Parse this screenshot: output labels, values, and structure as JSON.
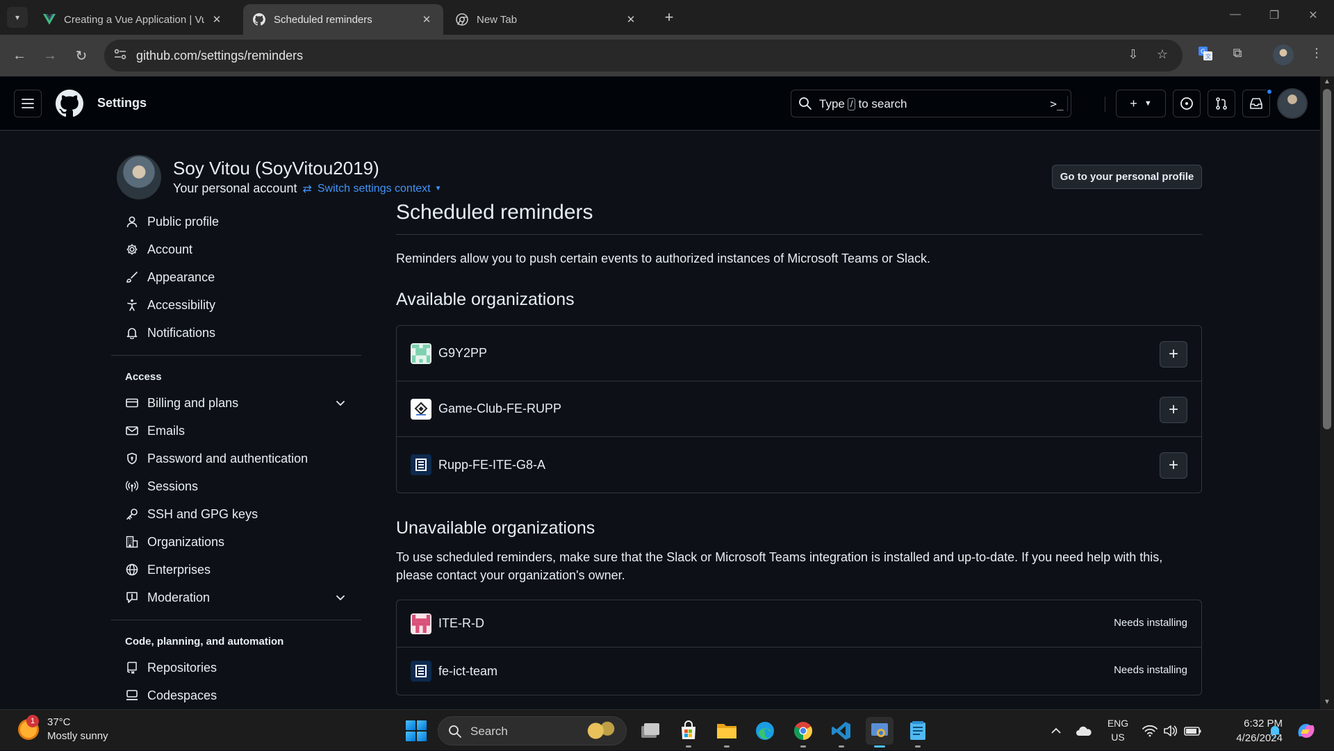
{
  "browser": {
    "tabs": [
      {
        "title": "Creating a Vue Application | Vu",
        "icon": "vue-icon",
        "active": false
      },
      {
        "title": "Scheduled reminders",
        "icon": "github-icon",
        "active": true
      },
      {
        "title": "New Tab",
        "icon": "chrome-icon",
        "active": false
      }
    ],
    "url": "github.com/settings/reminders"
  },
  "header": {
    "context": "Settings",
    "search_prefix": "Type",
    "search_key": "/",
    "search_suffix": "to search"
  },
  "profile": {
    "name": "Soy Vitou (SoyVitou2019)",
    "subtitle": "Your personal account",
    "switch_label": "Switch settings context",
    "go_profile_label": "Go to your personal profile"
  },
  "sidebar": {
    "group1": [
      {
        "label": "Public profile",
        "icon": "person-icon"
      },
      {
        "label": "Account",
        "icon": "gear-icon"
      },
      {
        "label": "Appearance",
        "icon": "paintbrush-icon"
      },
      {
        "label": "Accessibility",
        "icon": "accessibility-icon"
      },
      {
        "label": "Notifications",
        "icon": "bell-icon"
      }
    ],
    "access_heading": "Access",
    "group2": [
      {
        "label": "Billing and plans",
        "icon": "credit-card-icon"
      },
      {
        "label": "Emails",
        "icon": "mail-icon"
      },
      {
        "label": "Password and authentication",
        "icon": "shield-lock-icon"
      },
      {
        "label": "Sessions",
        "icon": "broadcast-icon"
      },
      {
        "label": "SSH and GPG keys",
        "icon": "key-icon"
      },
      {
        "label": "Organizations",
        "icon": "organization-icon"
      },
      {
        "label": "Enterprises",
        "icon": "globe-icon"
      },
      {
        "label": "Moderation",
        "icon": "report-icon"
      }
    ],
    "code_heading": "Code, planning, and automation",
    "group3": [
      {
        "label": "Repositories",
        "icon": "repo-icon"
      },
      {
        "label": "Codespaces",
        "icon": "codespaces-icon"
      }
    ]
  },
  "main": {
    "title": "Scheduled reminders",
    "lead": "Reminders allow you to push certain events to authorized instances of Microsoft Teams or Slack.",
    "available_heading": "Available organizations",
    "available": [
      "G9Y2PP",
      "Game-Club-FE-RUPP",
      "Rupp-FE-ITE-G8-A"
    ],
    "unavailable_heading": "Unavailable organizations",
    "unavailable_help": "To use scheduled reminders, make sure that the Slack or Microsoft Teams integration is installed and up-to-date. If you need help with this, please contact your organization's owner.",
    "unavailable": [
      {
        "name": "ITE-R-D",
        "status": "Needs installing"
      },
      {
        "name": "fe-ict-team",
        "status": "Needs installing"
      }
    ]
  },
  "taskbar": {
    "weather_temp": "37°C",
    "weather_desc": "Mostly sunny",
    "weather_badge": "1",
    "search_label": "Search",
    "lang_top": "ENG",
    "lang_bottom": "US",
    "time": "6:32 PM",
    "date": "4/26/2024"
  },
  "colors": {
    "page_bg": "#0d1117",
    "header_bg": "#010409",
    "border": "#30363d",
    "link": "#4493f8",
    "text": "#e6edf3"
  }
}
